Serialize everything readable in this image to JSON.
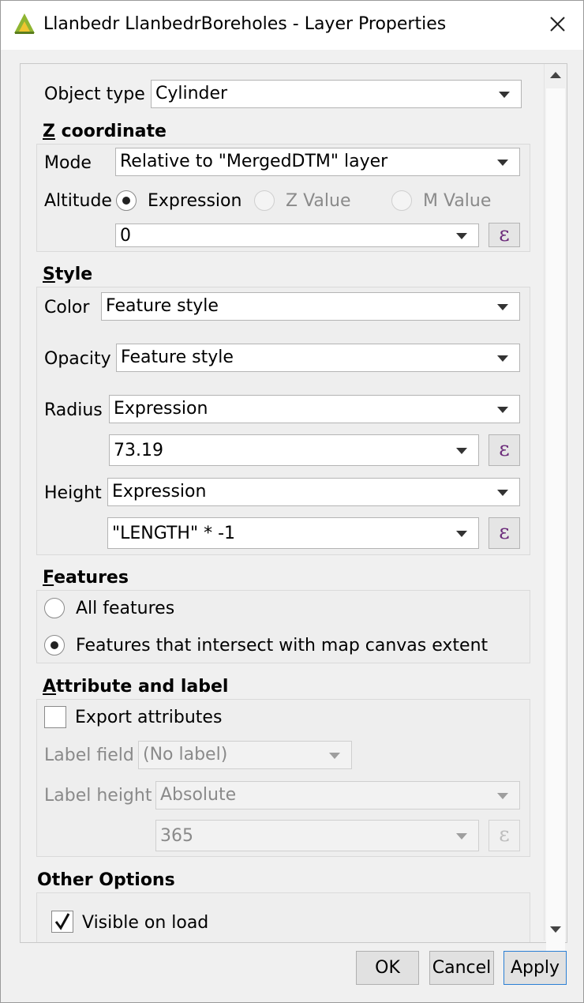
{
  "window": {
    "title": "Llanbedr LlanbedrBoreholes - Layer Properties",
    "app_icon": "qgis-icon",
    "close_icon": "close-icon"
  },
  "object_type": {
    "label": "Object type",
    "value": "Cylinder"
  },
  "z_coordinate": {
    "title_underline": "Z",
    "title_rest": " coordinate",
    "mode_label": "Mode",
    "mode_value": "Relative to \"MergedDTM\" layer",
    "altitude_label": "Altitude",
    "altitude_options": [
      "Expression",
      "Z Value",
      "M Value"
    ],
    "altitude_selected": "Expression",
    "expression_value": "0"
  },
  "style": {
    "title_underline": "S",
    "title_rest": "tyle",
    "color_label": "Color",
    "color_value": "Feature style",
    "opacity_label": "Opacity",
    "opacity_value": "Feature style",
    "radius_label": "Radius",
    "radius_mode": "Expression",
    "radius_value": "73.19",
    "height_label": "Height",
    "height_mode": "Expression",
    "height_value": "\"LENGTH\" * -1"
  },
  "features": {
    "title_underline": "F",
    "title_rest": "eatures",
    "options": [
      "All features",
      "Features that intersect with map canvas extent"
    ],
    "selected": "Features that intersect with map canvas extent"
  },
  "attribute_label": {
    "title_underline": "A",
    "title_rest": "ttribute and label",
    "export_label": "Export attributes",
    "export_checked": false,
    "label_field_label": "Label field",
    "label_field_value": "(No label)",
    "label_height_label": "Label height",
    "label_height_mode": "Absolute",
    "label_height_value": "365"
  },
  "other_options": {
    "title": "Other Options",
    "visible_on_load_label": "Visible on load",
    "visible_on_load_checked": true
  },
  "buttons": {
    "ok": "OK",
    "cancel": "Cancel",
    "apply": "Apply"
  },
  "expression_glyph": "ε",
  "colors": {
    "expression_icon": "#6b2a7a",
    "accent_border": "#2b7fd4",
    "qgis_green": "#8fb531",
    "qgis_yellow": "#eec530"
  }
}
